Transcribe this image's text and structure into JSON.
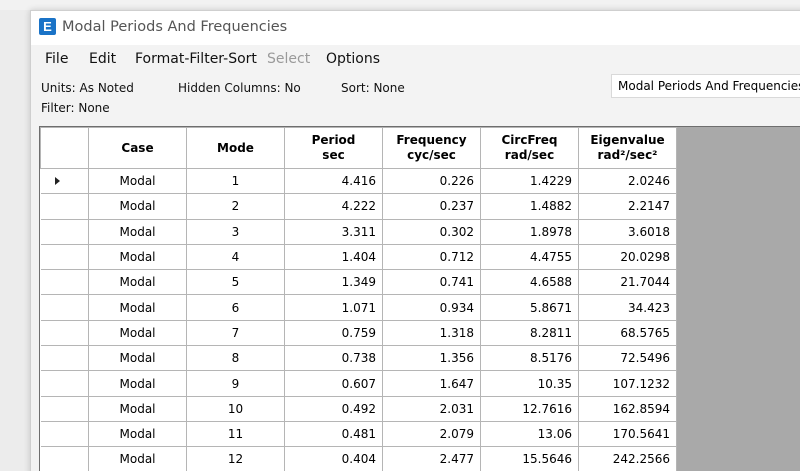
{
  "window": {
    "title": "Modal Periods And Frequencies",
    "icon": "E"
  },
  "menu": [
    "File",
    "Edit",
    "Format-Filter-Sort",
    "Select",
    "Options"
  ],
  "info": {
    "units": "Units: As Noted",
    "hidden": "Hidden Columns: No",
    "sort": "Sort: None",
    "filter": "Filter: None",
    "table_select": "Modal Periods And Frequencies"
  },
  "table": {
    "headers": [
      [
        "Case",
        ""
      ],
      [
        "Mode",
        ""
      ],
      [
        "Period",
        "sec"
      ],
      [
        "Frequency",
        "cyc/sec"
      ],
      [
        "CircFreq",
        "rad/sec"
      ],
      [
        "Eigenvalue",
        "rad²/sec²"
      ]
    ],
    "rows": [
      [
        "Modal",
        "1",
        "4.416",
        "0.226",
        "1.4229",
        "2.0246"
      ],
      [
        "Modal",
        "2",
        "4.222",
        "0.237",
        "1.4882",
        "2.2147"
      ],
      [
        "Modal",
        "3",
        "3.311",
        "0.302",
        "1.8978",
        "3.6018"
      ],
      [
        "Modal",
        "4",
        "1.404",
        "0.712",
        "4.4755",
        "20.0298"
      ],
      [
        "Modal",
        "5",
        "1.349",
        "0.741",
        "4.6588",
        "21.7044"
      ],
      [
        "Modal",
        "6",
        "1.071",
        "0.934",
        "5.8671",
        "34.423"
      ],
      [
        "Modal",
        "7",
        "0.759",
        "1.318",
        "8.2811",
        "68.5765"
      ],
      [
        "Modal",
        "8",
        "0.738",
        "1.356",
        "8.5176",
        "72.5496"
      ],
      [
        "Modal",
        "9",
        "0.607",
        "1.647",
        "10.35",
        "107.1232"
      ],
      [
        "Modal",
        "10",
        "0.492",
        "2.031",
        "12.7616",
        "162.8594"
      ],
      [
        "Modal",
        "11",
        "0.481",
        "2.079",
        "13.06",
        "170.5641"
      ],
      [
        "Modal",
        "12",
        "0.404",
        "2.477",
        "15.5646",
        "242.2566"
      ]
    ]
  }
}
